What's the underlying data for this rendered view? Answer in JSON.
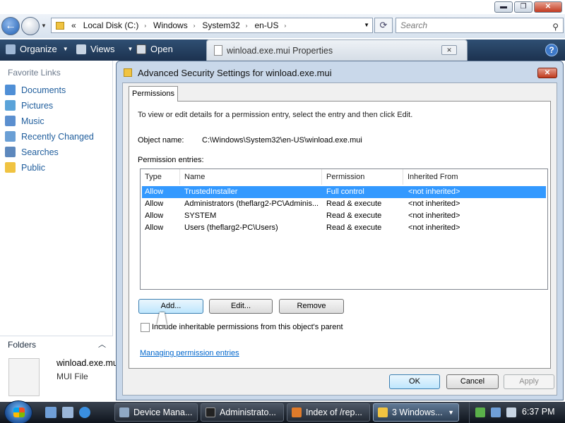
{
  "explorer": {
    "window_controls": {
      "minimize": "▬",
      "maximize": "❐",
      "close": "✕"
    },
    "address": {
      "history_prefix": "«",
      "segments": [
        "Local Disk (C:)",
        "Windows",
        "System32",
        "en-US"
      ],
      "separator": "›"
    },
    "search": {
      "placeholder": "Search",
      "icon": "search-icon"
    },
    "toolbar": {
      "organize": "Organize",
      "views": "Views",
      "open": "Open",
      "help": "?"
    },
    "nav": {
      "title": "Favorite Links",
      "items": [
        {
          "label": "Documents",
          "color": "#4f8fd6"
        },
        {
          "label": "Pictures",
          "color": "#5aa3d9"
        },
        {
          "label": "Music",
          "color": "#5b8fcf"
        },
        {
          "label": "Recently Changed",
          "color": "#6a9fd5"
        },
        {
          "label": "Searches",
          "color": "#5d88bd"
        },
        {
          "label": "Public",
          "color": "#f0c341"
        }
      ],
      "folders_label": "Folders"
    },
    "details": {
      "file_name": "winload.exe.mui",
      "file_type": "MUI File"
    }
  },
  "properties_tab": {
    "title": "winload.exe.mui Properties"
  },
  "dialog": {
    "title": "Advanced Security Settings for winload.exe.mui",
    "tab": "Permissions",
    "description": "To view or edit details for a permission entry, select the entry and then click Edit.",
    "object_name_label": "Object name:",
    "object_name_value": "C:\\Windows\\System32\\en-US\\winload.exe.mui",
    "entries_label": "Permission entries:",
    "table": {
      "headers": [
        "Type",
        "Name",
        "Permission",
        "Inherited From"
      ],
      "rows": [
        {
          "type": "Allow",
          "name": "TrustedInstaller",
          "permission": "Full control",
          "inherited": "<not inherited>"
        },
        {
          "type": "Allow",
          "name": "Administrators (theflarg2-PC\\Adminis...",
          "permission": "Read & execute",
          "inherited": "<not inherited>"
        },
        {
          "type": "Allow",
          "name": "SYSTEM",
          "permission": "Read & execute",
          "inherited": "<not inherited>"
        },
        {
          "type": "Allow",
          "name": "Users (theflarg2-PC\\Users)",
          "permission": "Read & execute",
          "inherited": "<not inherited>"
        }
      ]
    },
    "buttons": {
      "add": "Add...",
      "edit": "Edit...",
      "remove": "Remove",
      "ok": "OK",
      "cancel": "Cancel",
      "apply": "Apply"
    },
    "inherit_checkbox_label": "Include inheritable permissions from this object's parent",
    "inherit_checked": false,
    "manage_link": "Managing permission entries"
  },
  "taskbar": {
    "buttons": [
      {
        "label": "Device Mana...",
        "color": "#8fa8c4",
        "active": false
      },
      {
        "label": "Administrato...",
        "color": "#222222",
        "active": false
      },
      {
        "label": "Index of /rep...",
        "color": "#e07b2a",
        "active": false
      },
      {
        "label": "3 Windows...",
        "color": "#f0c341",
        "active": true
      }
    ],
    "clock": "6:37 PM"
  }
}
